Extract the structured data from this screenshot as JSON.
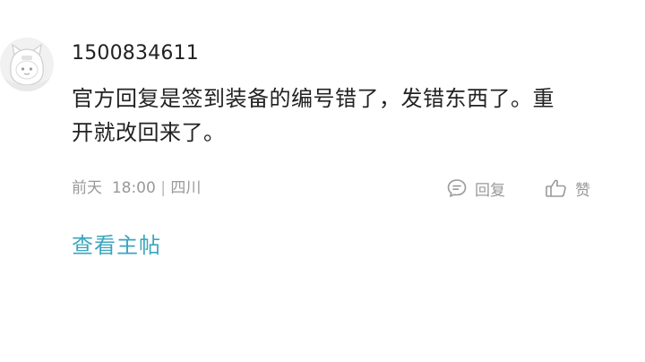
{
  "comment": {
    "username": "1500834611",
    "content": "官方回复是签到装备的编号错了，发错东西了。重开就改回来了。",
    "meta": {
      "date": "前天",
      "time": "18:00",
      "separator": "|",
      "location": "四川"
    },
    "actions": {
      "reply_label": "回复",
      "like_label": "赞"
    },
    "view_post_label": "查看主帖"
  },
  "icons": {
    "reply": "comment-bubble-icon",
    "like": "thumbs-up-icon",
    "avatar": "default-avatar-icon"
  },
  "colors": {
    "link": "#3aa6bd",
    "text": "#222222",
    "muted": "#999999"
  }
}
